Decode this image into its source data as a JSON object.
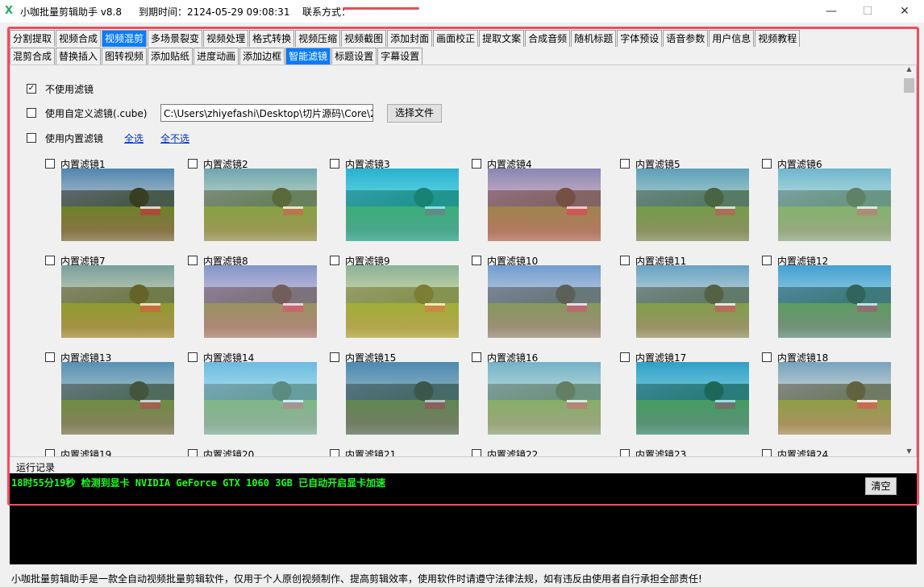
{
  "title": {
    "app": "小咖批量剪辑助手 v8.8",
    "expiry": "到期时间：2124-05-29 09:08:31",
    "contact": "联系方式："
  },
  "window_controls": {
    "minimize": "—",
    "maximize": "☐",
    "close": "✕"
  },
  "tabs_main": [
    "分割提取",
    "视频合成",
    "视频混剪",
    "多场景裂变",
    "视频处理",
    "格式转换",
    "视频压缩",
    "视频截图",
    "添加封面",
    "画面校正",
    "提取文案",
    "合成音频",
    "随机标题",
    "字体预设",
    "语音参数",
    "用户信息",
    "视频教程"
  ],
  "tabs_main_active": 2,
  "tabs_sub": [
    "混剪合成",
    "替换插入",
    "图转视频",
    "添加贴纸",
    "进度动画",
    "添加边框",
    "智能滤镜",
    "标题设置",
    "字幕设置"
  ],
  "tabs_sub_active": 6,
  "options": {
    "no_filter": "不使用滤镜",
    "no_filter_checked": true,
    "custom_filter": "使用自定义滤镜(.cube)",
    "custom_filter_checked": false,
    "custom_path": "C:\\Users\\zhiyefashi\\Desktop\\切片源码\\Core\\2",
    "choose_file": "选择文件",
    "builtin": "使用内置滤镜",
    "builtin_checked": false,
    "select_all": "全选",
    "select_none": "全不选"
  },
  "filters": [
    {
      "label": "内置滤镜1",
      "tint": "rgba(120,90,40,0.15)"
    },
    {
      "label": "内置滤镜2",
      "tint": "rgba(200,220,120,0.3)"
    },
    {
      "label": "内置滤镜3",
      "tint": "rgba(0,220,220,0.45)"
    },
    {
      "label": "内置滤镜4",
      "tint": "rgba(255,120,140,0.35)"
    },
    {
      "label": "内置滤镜5",
      "tint": "rgba(140,200,150,0.3)"
    },
    {
      "label": "内置滤镜6",
      "tint": "rgba(170,240,210,0.4)"
    },
    {
      "label": "内置滤镜7",
      "tint": "rgba(230,200,60,0.3)"
    },
    {
      "label": "内置滤镜8",
      "tint": "rgba(240,160,200,0.35)"
    },
    {
      "label": "内置滤镜9",
      "tint": "rgba(240,230,80,0.4)"
    },
    {
      "label": "内置滤镜10",
      "tint": "rgba(200,190,220,0.3)"
    },
    {
      "label": "内置滤镜11",
      "tint": "rgba(200,220,180,0.25)"
    },
    {
      "label": "内置滤镜12",
      "tint": "rgba(60,200,230,0.3)"
    },
    {
      "label": "内置滤镜13",
      "tint": "rgba(120,150,130,0.3)"
    },
    {
      "label": "内置滤镜14",
      "tint": "rgba(150,240,250,0.45)"
    },
    {
      "label": "内置滤镜15",
      "tint": "rgba(80,130,140,0.4)"
    },
    {
      "label": "内置滤镜16",
      "tint": "rgba(180,230,200,0.4)"
    },
    {
      "label": "内置滤镜17",
      "tint": "rgba(0,190,200,0.35)"
    },
    {
      "label": "内置滤镜18",
      "tint": "rgba(255,220,160,0.25)"
    },
    {
      "label": "内置滤镜19",
      "tint": ""
    },
    {
      "label": "内置滤镜20",
      "tint": ""
    },
    {
      "label": "内置滤镜21",
      "tint": ""
    },
    {
      "label": "内置滤镜22",
      "tint": ""
    },
    {
      "label": "内置滤镜23",
      "tint": ""
    },
    {
      "label": "内置滤镜24",
      "tint": ""
    }
  ],
  "log": {
    "label": "运行记录",
    "text": "18时55分19秒 检测到显卡 NVIDIA GeForce GTX 1060 3GB 已自动开启显卡加速",
    "clear": "清空"
  },
  "footer": "小咖批量剪辑助手是一款全自动视频批量剪辑软件，仅用于个人原创视频制作、提高剪辑效率，使用软件时请遵守法律法规，如有违反由使用者自行承担全部责任!",
  "colors": {
    "accent": "#0a7cff",
    "highlight_border": "#ef4d5e",
    "log_text": "#1eff1e"
  }
}
